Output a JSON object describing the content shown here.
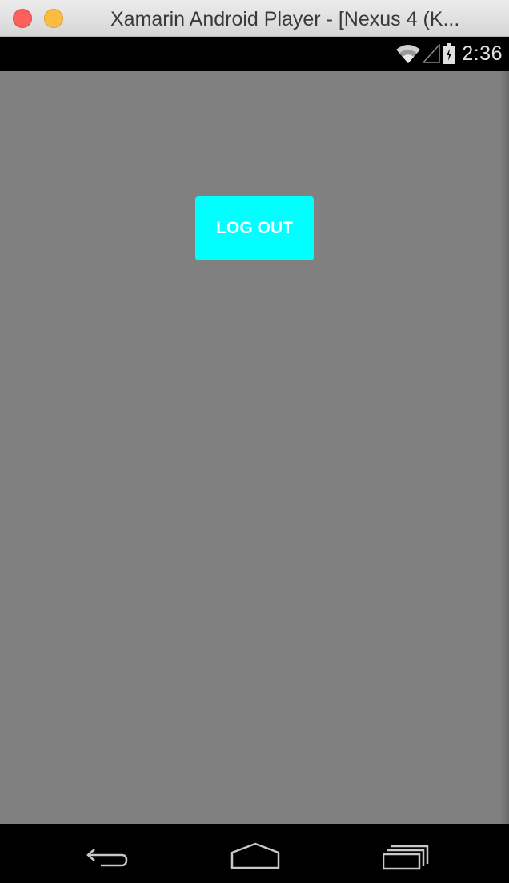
{
  "window": {
    "title": "Xamarin Android Player - [Nexus 4 (K..."
  },
  "statusbar": {
    "time": "2:36",
    "icons": [
      "wifi-icon",
      "cell-signal-icon",
      "battery-icon"
    ]
  },
  "app": {
    "logout_label": "LOG OUT",
    "background_color": "#808080",
    "button_color": "#00ffff"
  },
  "navbar": {
    "buttons": [
      "back-icon",
      "home-icon",
      "recents-icon"
    ]
  }
}
